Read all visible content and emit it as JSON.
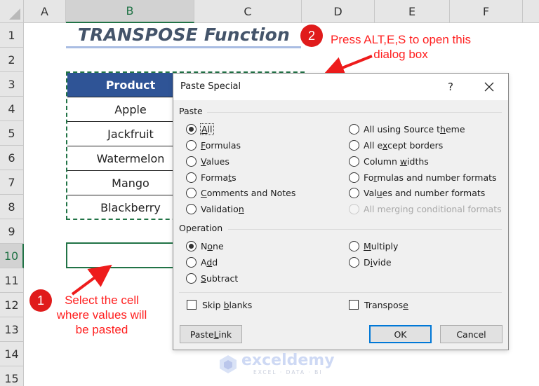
{
  "sheet": {
    "columns": [
      "A",
      "B",
      "C",
      "D",
      "E",
      "F"
    ],
    "selected_column": "B",
    "rows": [
      "1",
      "2",
      "3",
      "4",
      "5",
      "6",
      "7",
      "8",
      "9",
      "10",
      "11",
      "12",
      "13",
      "14",
      "15"
    ],
    "selected_row": "10",
    "title": "TRANSPOSE Function",
    "table": {
      "header": "Product",
      "items": [
        "Apple",
        "Jackfruit",
        "Watermelon",
        "Mango",
        "Blackberry"
      ]
    },
    "target_cell": "B10"
  },
  "annotations": {
    "step1": {
      "number": "1",
      "lines": [
        "Select the cell",
        "where values will",
        "be pasted"
      ]
    },
    "step2": {
      "number": "2",
      "lines": [
        "Press ALT,E,S to open this",
        "dialog box"
      ]
    },
    "color": "#ff2020"
  },
  "dialog": {
    "title": "Paste Special",
    "help_label": "?",
    "paste_group": {
      "label": "Paste",
      "left": [
        {
          "pre": "",
          "u": "A",
          "post": "ll",
          "selected": true,
          "focused": true
        },
        {
          "pre": "",
          "u": "F",
          "post": "ormulas",
          "selected": false
        },
        {
          "pre": "",
          "u": "V",
          "post": "alues",
          "selected": false
        },
        {
          "pre": "Forma",
          "u": "t",
          "post": "s",
          "selected": false
        },
        {
          "pre": "",
          "u": "C",
          "post": "omments and Notes",
          "selected": false
        },
        {
          "pre": "Validatio",
          "u": "n",
          "post": "",
          "selected": false
        }
      ],
      "right": [
        {
          "pre": "All using Source t",
          "u": "h",
          "post": "eme",
          "selected": false,
          "disabled": false
        },
        {
          "pre": "All e",
          "u": "x",
          "post": "cept borders",
          "selected": false,
          "disabled": false
        },
        {
          "pre": "Column ",
          "u": "w",
          "post": "idths",
          "selected": false,
          "disabled": false
        },
        {
          "pre": "Fo",
          "u": "r",
          "post": "mulas and number formats",
          "selected": false,
          "disabled": false
        },
        {
          "pre": "Val",
          "u": "u",
          "post": "es and number formats",
          "selected": false,
          "disabled": false
        },
        {
          "pre": "All merging conditional formats",
          "u": "",
          "post": "",
          "selected": false,
          "disabled": true
        }
      ]
    },
    "operation_group": {
      "label": "Operation",
      "left": [
        {
          "pre": "N",
          "u": "o",
          "post": "ne",
          "selected": true
        },
        {
          "pre": "A",
          "u": "d",
          "post": "d",
          "selected": false
        },
        {
          "pre": "",
          "u": "S",
          "post": "ubtract",
          "selected": false
        }
      ],
      "right": [
        {
          "pre": "",
          "u": "M",
          "post": "ultiply",
          "selected": false
        },
        {
          "pre": "D",
          "u": "i",
          "post": "vide",
          "selected": false
        }
      ]
    },
    "checkboxes": [
      {
        "pre": "Skip ",
        "u": "b",
        "post": "lanks",
        "checked": false
      },
      {
        "pre": "Transpos",
        "u": "e",
        "post": "",
        "checked": false
      }
    ],
    "buttons": {
      "paste_link": {
        "pre": "Paste ",
        "u": "L",
        "post": "ink"
      },
      "ok": "OK",
      "cancel": "Cancel"
    }
  },
  "watermark": {
    "name": "exceldemy",
    "tagline": "EXCEL · DATA · BI"
  }
}
